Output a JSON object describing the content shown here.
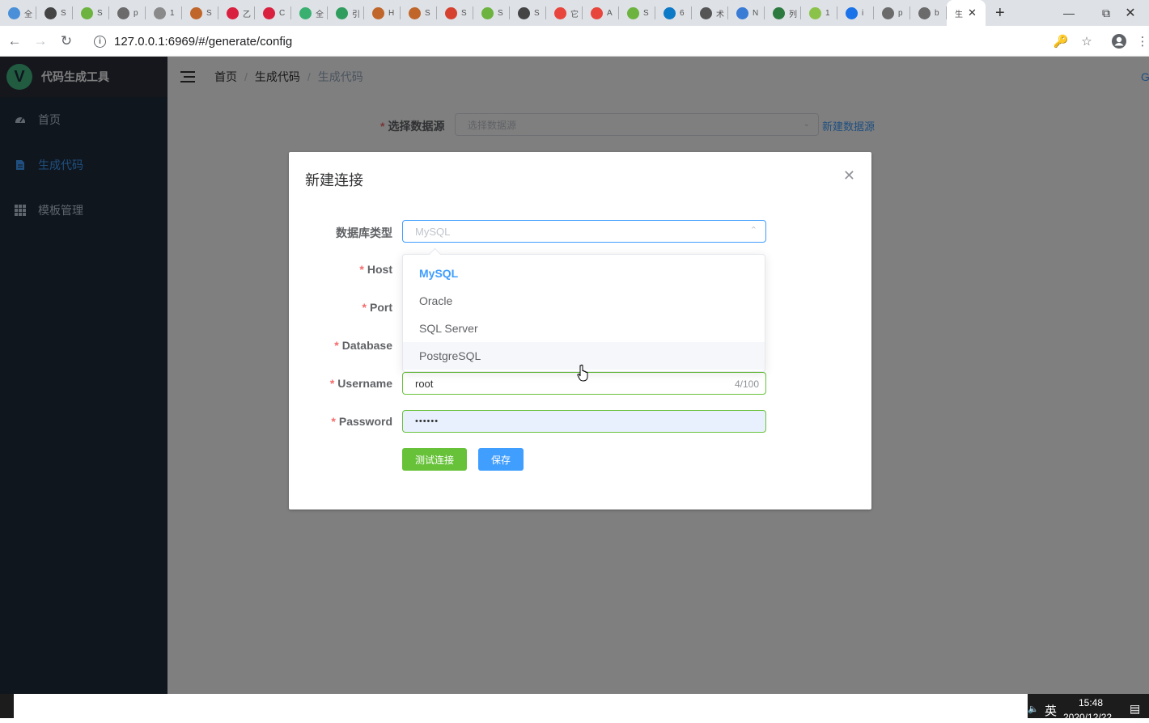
{
  "browser": {
    "tabs": [
      {
        "icon": "ab-icon",
        "letter": "全",
        "color": "#4a90d9"
      },
      {
        "icon": "monkey-icon",
        "letter": "S",
        "color": "#444444"
      },
      {
        "icon": "spring-icon",
        "letter": "S",
        "color": "#6db33f"
      },
      {
        "icon": "globe-icon",
        "letter": "p",
        "color": "#6b6b6b"
      },
      {
        "icon": "globe-icon",
        "letter": "1",
        "color": "#8a8a8a"
      },
      {
        "icon": "lion-icon",
        "letter": "S",
        "color": "#c0662a"
      },
      {
        "icon": "g-icon",
        "letter": "乙",
        "color": "#d9213f"
      },
      {
        "icon": "g-icon",
        "letter": "C",
        "color": "#d9213f"
      },
      {
        "icon": "vue-icon",
        "letter": "全",
        "color": "#3ab070"
      },
      {
        "icon": "d-icon",
        "letter": "引",
        "color": "#2f9d5d"
      },
      {
        "icon": "lion-icon",
        "letter": "H",
        "color": "#c0662a"
      },
      {
        "icon": "lion-icon",
        "letter": "S",
        "color": "#c0662a"
      },
      {
        "icon": "c-icon",
        "letter": "S",
        "color": "#d6402f"
      },
      {
        "icon": "spring-icon",
        "letter": "S",
        "color": "#6db33f"
      },
      {
        "icon": "monkey-icon",
        "letter": "S",
        "color": "#444444"
      },
      {
        "icon": "c-icon",
        "letter": "它",
        "color": "#e8453c"
      },
      {
        "icon": "c-icon",
        "letter": "A",
        "color": "#e8453c"
      },
      {
        "icon": "spring-icon",
        "letter": "S",
        "color": "#6db33f"
      },
      {
        "icon": "zhihu-icon",
        "letter": "6",
        "color": "#0d7ac7"
      },
      {
        "icon": "globe-icon",
        "letter": "术",
        "color": "#555555"
      },
      {
        "icon": "robot-icon",
        "letter": "N",
        "color": "#3a7bd5"
      },
      {
        "icon": "globe-icon",
        "letter": "列",
        "color": "#2c7a3f"
      },
      {
        "icon": "leaf-icon",
        "letter": "1",
        "color": "#8bc34a"
      },
      {
        "icon": "gear-icon",
        "letter": "i",
        "color": "#1a73e8"
      },
      {
        "icon": "globe-icon",
        "letter": "p",
        "color": "#6b6b6b"
      },
      {
        "icon": "globe-icon",
        "letter": "b",
        "color": "#6b6b6b"
      }
    ],
    "active_tab_letter": "生",
    "url": "127.0.0.1:6969/#/generate/config"
  },
  "app": {
    "title": "代码生成工具",
    "logo_letter": "V",
    "menu": [
      {
        "label": "首页",
        "icon": "dashboard-icon"
      },
      {
        "label": "生成代码",
        "icon": "document-icon"
      },
      {
        "label": "模板管理",
        "icon": "grid-icon"
      }
    ],
    "breadcrumb": [
      "首页",
      "生成代码",
      "生成代码"
    ],
    "nav_right": "G"
  },
  "page": {
    "ds_label": "选择数据源",
    "ds_placeholder": "选择数据源",
    "ds_link": "新建数据源"
  },
  "dialog": {
    "title": "新建连接",
    "db_type_label": "数据库类型",
    "db_type_value": "MySQL",
    "host_label": "Host",
    "port_label": "Port",
    "database_label": "Database",
    "username_label": "Username",
    "username_value": "root",
    "username_count": "4/100",
    "password_label": "Password",
    "password_value": "••••••",
    "test_button": "测试连接",
    "save_button": "保存",
    "options": [
      "MySQL",
      "Oracle",
      "SQL Server",
      "PostgreSQL"
    ]
  },
  "taskbar": {
    "ime": "英",
    "time": "15:48",
    "date": "2020/12/22"
  },
  "colors": {
    "sidebar": "#1f2d3d",
    "primary": "#409eff",
    "success": "#67c23a"
  }
}
